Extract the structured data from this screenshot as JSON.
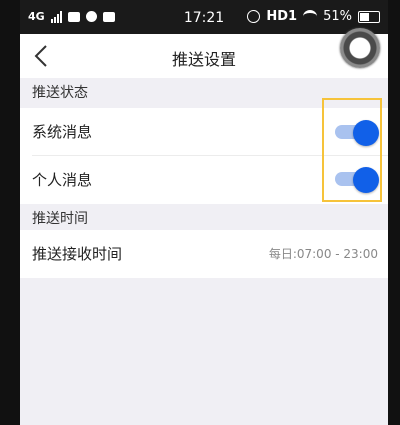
{
  "status_bar": {
    "network": "4G",
    "time": "17:21",
    "carrier": "HD1",
    "battery": "51%"
  },
  "nav": {
    "title": "推送设置"
  },
  "sections": {
    "push_status": {
      "header": "推送状态",
      "items": [
        {
          "label": "系统消息",
          "enabled": true
        },
        {
          "label": "个人消息",
          "enabled": true
        }
      ]
    },
    "push_time": {
      "header": "推送时间",
      "items": [
        {
          "label": "推送接收时间",
          "value": "每日:07:00 - 23:00"
        }
      ]
    }
  },
  "colors": {
    "toggle_on": "#1160e8",
    "toggle_track": "#a9c2ef",
    "highlight": "#f6c33a",
    "background": "#f0eff4"
  },
  "icons": {
    "back": "chevron-left-icon"
  }
}
